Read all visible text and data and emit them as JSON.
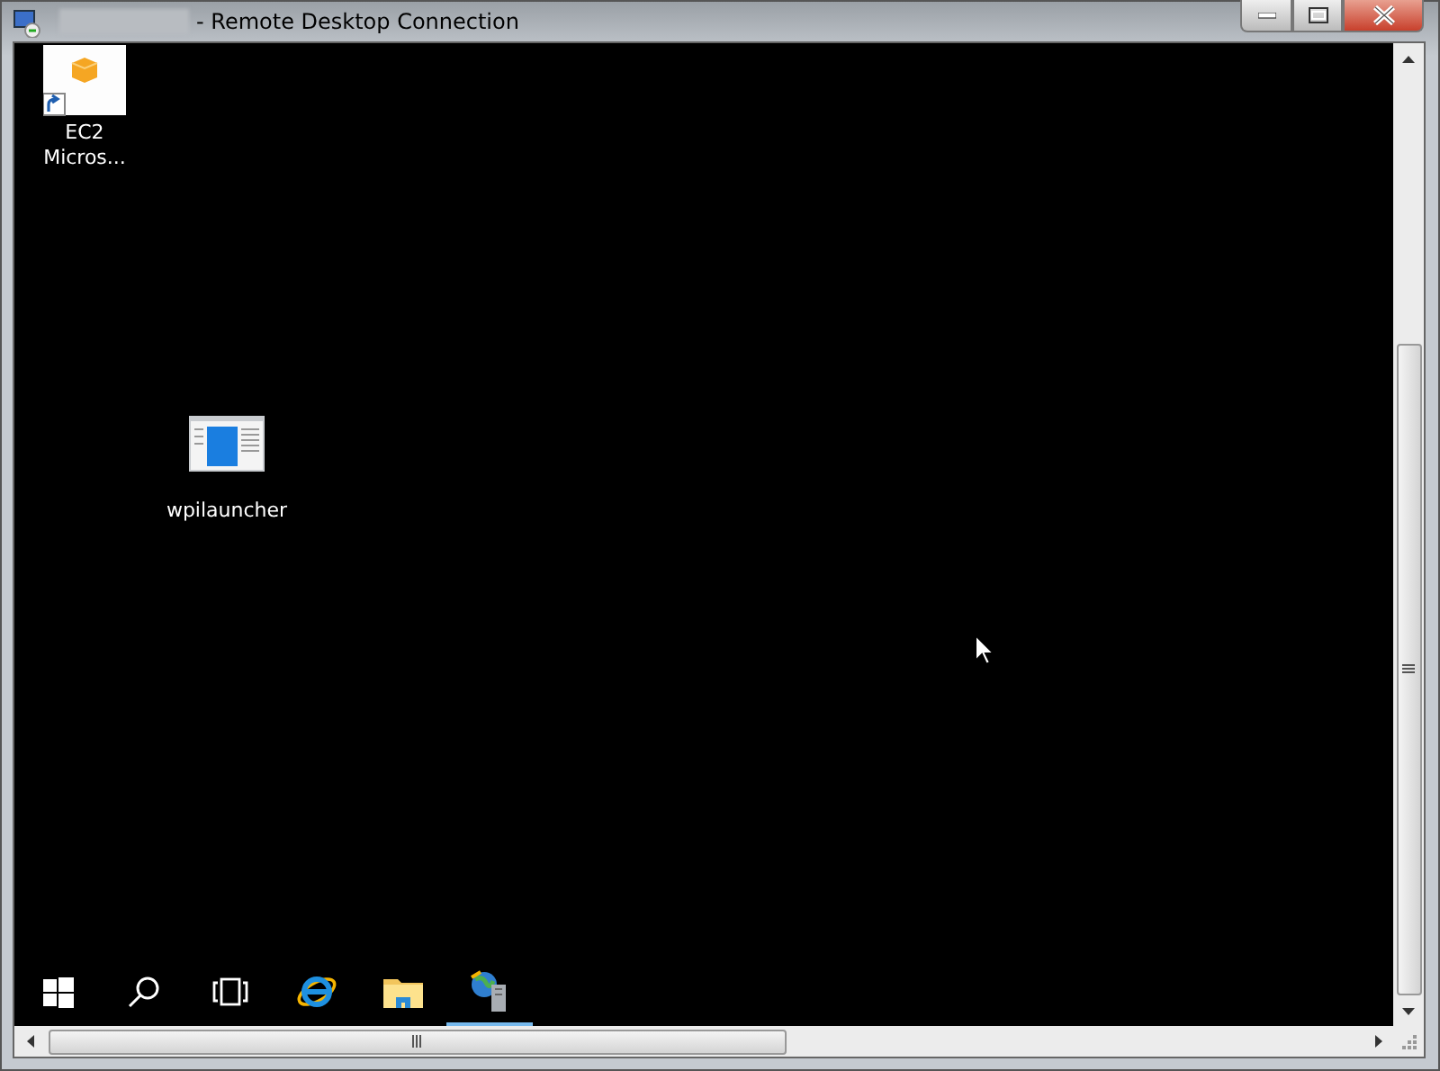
{
  "window": {
    "title": "- Remote Desktop Connection"
  },
  "desktop_icons": [
    {
      "label": "EC2 Micros...",
      "kind": "shortcut"
    },
    {
      "label": "wpilauncher",
      "kind": "app"
    }
  ],
  "taskbar": {
    "items": [
      {
        "kind": "start",
        "selected": false
      },
      {
        "kind": "search",
        "selected": false
      },
      {
        "kind": "taskview",
        "selected": false
      },
      {
        "kind": "browser",
        "selected": false
      },
      {
        "kind": "folder",
        "selected": false
      },
      {
        "kind": "remote",
        "selected": true
      }
    ]
  }
}
